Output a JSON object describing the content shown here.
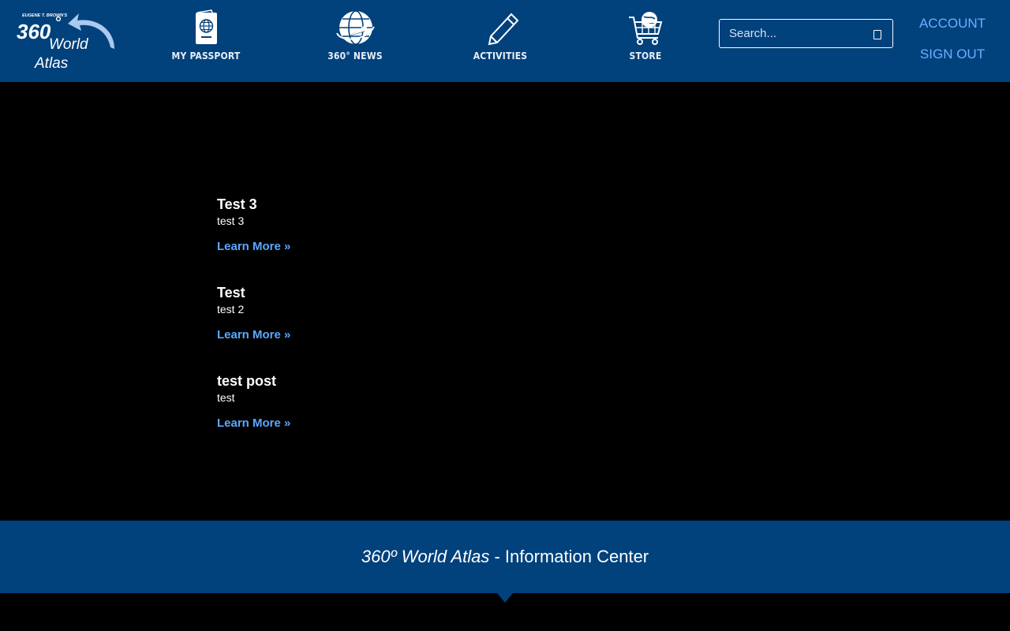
{
  "brand": {
    "byline": "EUGENE T. BROWN'S",
    "number": "360",
    "line1": "World",
    "line2": "Atlas",
    "colors": {
      "header": "#01417c",
      "link": "#5aa8ff",
      "account_link": "#6ab0ff"
    }
  },
  "nav": [
    {
      "label": "MY PASSPORT",
      "icon": "passport-icon"
    },
    {
      "label": "360° NEWS",
      "icon": "globe-plane-icon"
    },
    {
      "label": "ACTIVITIES",
      "icon": "pencil-icon"
    },
    {
      "label": "STORE",
      "icon": "shopping-cart-icon"
    }
  ],
  "search": {
    "placeholder": "Search...",
    "value": ""
  },
  "account": {
    "account_label": "ACCOUNT",
    "signout_label": "SIGN OUT"
  },
  "posts": [
    {
      "title": "Test 3",
      "excerpt": "test 3",
      "link": "Learn More »"
    },
    {
      "title": "Test",
      "excerpt": "test 2",
      "link": "Learn More »"
    },
    {
      "title": "test post",
      "excerpt": "test",
      "link": "Learn More »"
    }
  ],
  "footer": {
    "brand": "360º World Atlas",
    "suffix": " - Information Center"
  }
}
